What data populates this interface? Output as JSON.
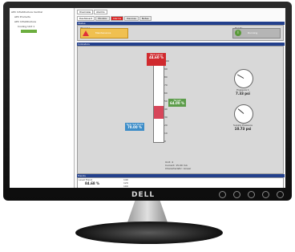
{
  "tree": {
    "root": "APC InfraStruXure Central",
    "items": [
      "APC Products",
      "APC InfraStruXure",
      "Cooling Unit 1"
    ]
  },
  "tabs": {
    "top": [
      "Overview",
      "Alarms"
    ],
    "sub": [
      "Dashboard",
      "Monitor",
      "Alarms",
      "Devices",
      "Notes"
    ]
  },
  "status_panel": {
    "title": "Status",
    "left_label": "Warning",
    "warning_text": "Maintenance",
    "right_label": "Ready",
    "ready_text": "Running"
  },
  "indicators_panel": {
    "title": "Indicators",
    "tank_ticks": [
      "100",
      "90",
      "80",
      "70",
      "60",
      "50",
      "40",
      "30",
      "20",
      "10",
      "0"
    ],
    "tank_level_fraction": 0.45,
    "top_callout": {
      "label": "Tank Level",
      "value": "44.60 %"
    },
    "right_callout": {
      "label": "Target",
      "value": "64.00 %"
    },
    "left_callout": {
      "label": "Tank Set Point",
      "value": "70.00 %"
    },
    "info_lines": [
      "Unit: 4",
      "Current: 15.00 mA",
      "Characteristic: Linear"
    ],
    "gauge1": {
      "label": "Pressure 1",
      "value": "7.33 psi"
    },
    "gauge2": {
      "label": "Supply Pressure",
      "value": "10.73 psi"
    }
  },
  "trends_panel": {
    "title": "Trends",
    "rows": [
      {
        "label": "Level Trend",
        "value": "84.68 %"
      },
      {
        "label": "Tank Set Point",
        "value": "70.00 %"
      }
    ],
    "axis": [
      "140",
      "120",
      "100",
      "80"
    ]
  },
  "monitor": {
    "brand": "DELL"
  }
}
